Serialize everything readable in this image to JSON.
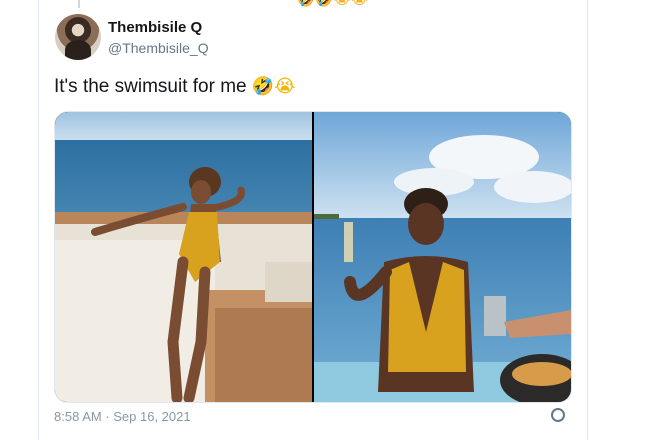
{
  "header": {
    "top_emojis": "🤣🤣😭😭",
    "display_name": "Thembisile Q",
    "handle": "@Thembisile_Q"
  },
  "tweet": {
    "text": "It's the swimsuit for me",
    "emojis": "🤣😭",
    "timestamp": "8:58 AM · Sep 16, 2021"
  },
  "media": {
    "photos": [
      {
        "name": "photo-yacht"
      },
      {
        "name": "photo-pool"
      }
    ]
  },
  "colors": {
    "text": "#14171a",
    "secondary": "#657786",
    "border": "#e1e8ed",
    "swimsuit": "#d8a21f"
  },
  "icons": [
    "avatar",
    "info-icon"
  ]
}
